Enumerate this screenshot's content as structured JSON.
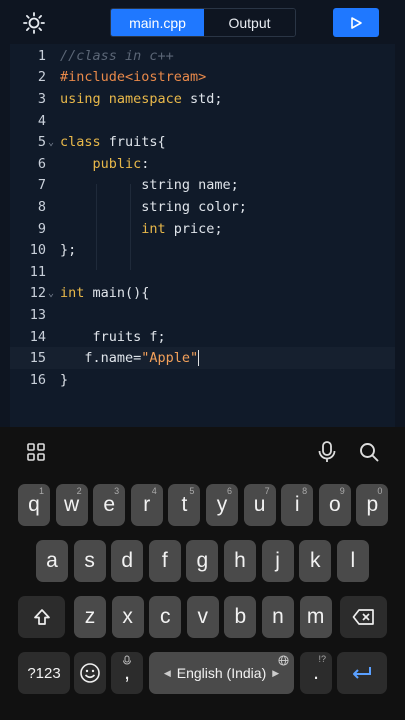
{
  "header": {
    "tabs": [
      {
        "label": "main.cpp",
        "active": true
      },
      {
        "label": "Output",
        "active": false
      }
    ],
    "icons": {
      "theme": "sun-icon",
      "run": "play-icon"
    },
    "accent_color": "#1f78ff"
  },
  "editor": {
    "lines": [
      {
        "num": "1",
        "fold": false,
        "tokens": [
          {
            "t": "//class in c++",
            "c": "cm"
          }
        ]
      },
      {
        "num": "2",
        "fold": false,
        "tokens": [
          {
            "t": "#include",
            "c": "pp"
          },
          {
            "t": "<iostream>",
            "c": "pp"
          }
        ]
      },
      {
        "num": "3",
        "fold": false,
        "tokens": [
          {
            "t": "using namespace ",
            "c": "kw"
          },
          {
            "t": "std;",
            "c": ""
          }
        ]
      },
      {
        "num": "4",
        "fold": false,
        "tokens": []
      },
      {
        "num": "5",
        "fold": true,
        "tokens": [
          {
            "t": "class ",
            "c": "kw"
          },
          {
            "t": "fruits{",
            "c": ""
          }
        ]
      },
      {
        "num": "6",
        "fold": false,
        "tokens": [
          {
            "t": "    ",
            "c": ""
          },
          {
            "t": "public",
            "c": "kw"
          },
          {
            "t": ":",
            "c": ""
          }
        ]
      },
      {
        "num": "7",
        "fold": false,
        "tokens": [
          {
            "t": "          string name;",
            "c": ""
          }
        ]
      },
      {
        "num": "8",
        "fold": false,
        "tokens": [
          {
            "t": "          string color;",
            "c": ""
          }
        ]
      },
      {
        "num": "9",
        "fold": false,
        "tokens": [
          {
            "t": "          ",
            "c": ""
          },
          {
            "t": "int",
            "c": "ty"
          },
          {
            "t": " price;",
            "c": ""
          }
        ]
      },
      {
        "num": "10",
        "fold": false,
        "tokens": [
          {
            "t": "};",
            "c": ""
          }
        ]
      },
      {
        "num": "11",
        "fold": false,
        "tokens": []
      },
      {
        "num": "12",
        "fold": true,
        "tokens": [
          {
            "t": "int",
            "c": "ty"
          },
          {
            "t": " main(){",
            "c": ""
          }
        ]
      },
      {
        "num": "13",
        "fold": false,
        "tokens": []
      },
      {
        "num": "14",
        "fold": false,
        "tokens": [
          {
            "t": "    fruits f;",
            "c": ""
          }
        ]
      },
      {
        "num": "15",
        "fold": false,
        "current": true,
        "tokens": [
          {
            "t": "   f.name=",
            "c": ""
          },
          {
            "t": "\"Apple\"",
            "c": "st"
          }
        ],
        "cursor": true
      },
      {
        "num": "16",
        "fold": false,
        "tokens": [
          {
            "t": "}",
            "c": ""
          }
        ]
      }
    ]
  },
  "keyboard": {
    "toolbar_icons": [
      "grid-icon",
      "mic-icon",
      "search-icon"
    ],
    "row1": [
      {
        "k": "q",
        "h": "1"
      },
      {
        "k": "w",
        "h": "2"
      },
      {
        "k": "e",
        "h": "3"
      },
      {
        "k": "r",
        "h": "4"
      },
      {
        "k": "t",
        "h": "5"
      },
      {
        "k": "y",
        "h": "6"
      },
      {
        "k": "u",
        "h": "7"
      },
      {
        "k": "i",
        "h": "8"
      },
      {
        "k": "o",
        "h": "9"
      },
      {
        "k": "p",
        "h": "0"
      }
    ],
    "row2": [
      "a",
      "s",
      "d",
      "f",
      "g",
      "h",
      "j",
      "k",
      "l"
    ],
    "row3": [
      "z",
      "x",
      "c",
      "v",
      "b",
      "n",
      "m"
    ],
    "symbols_label": "?123",
    "comma_label": ",",
    "period_label": ".",
    "period_hint": "!?",
    "space_label": "English (India)",
    "icons": {
      "shift": "shift-icon",
      "backspace": "backspace-icon",
      "emoji": "emoji-icon",
      "enter": "enter-icon",
      "globe": "globe-icon"
    }
  }
}
